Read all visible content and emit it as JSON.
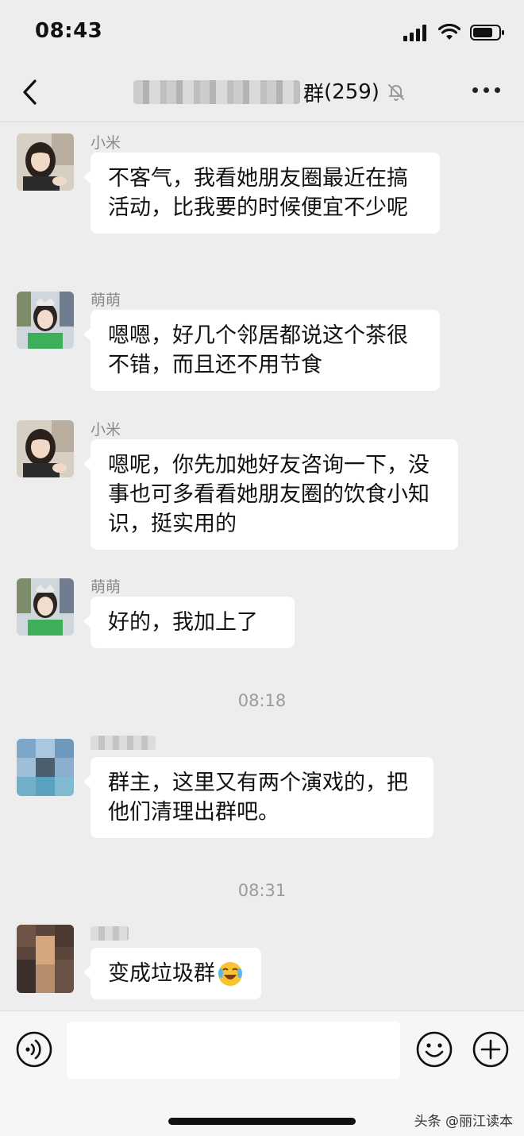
{
  "status_bar": {
    "time": "08:43"
  },
  "header": {
    "title_suffix": "群",
    "member_count": "(259)"
  },
  "messages": [
    {
      "sender": "小米",
      "text": "不客气，我看她朋友圈最近在搞活动，比我要的时候便宜不少呢"
    },
    {
      "sender": "萌萌",
      "text": "嗯嗯，好几个邻居都说这个茶很不错，而且还不用节食"
    },
    {
      "sender": "小米",
      "text": "嗯呢，你先加她好友咨询一下，没事也可多看看她朋友圈的饮食小知识，挺实用的"
    },
    {
      "sender": "萌萌",
      "text": "好的，我加上了"
    },
    {
      "text": "群主，这里又有两个演戏的，把他们清理出群吧。"
    },
    {
      "text": "变成垃圾群"
    }
  ],
  "timestamps": [
    "08:18",
    "08:31"
  ],
  "watermark": "头条 @丽江读本",
  "icons": {
    "back": "chevron-left-icon",
    "mute": "bell-off-icon",
    "more": "more-dots-icon",
    "voice": "voice-icon",
    "emoji": "emoji-icon",
    "plus": "plus-icon",
    "crying_laughing": "crying-laughing-emoji"
  },
  "colors": {
    "background": "#ededed",
    "bubble": "#ffffff",
    "input_bar": "#f6f6f6"
  }
}
